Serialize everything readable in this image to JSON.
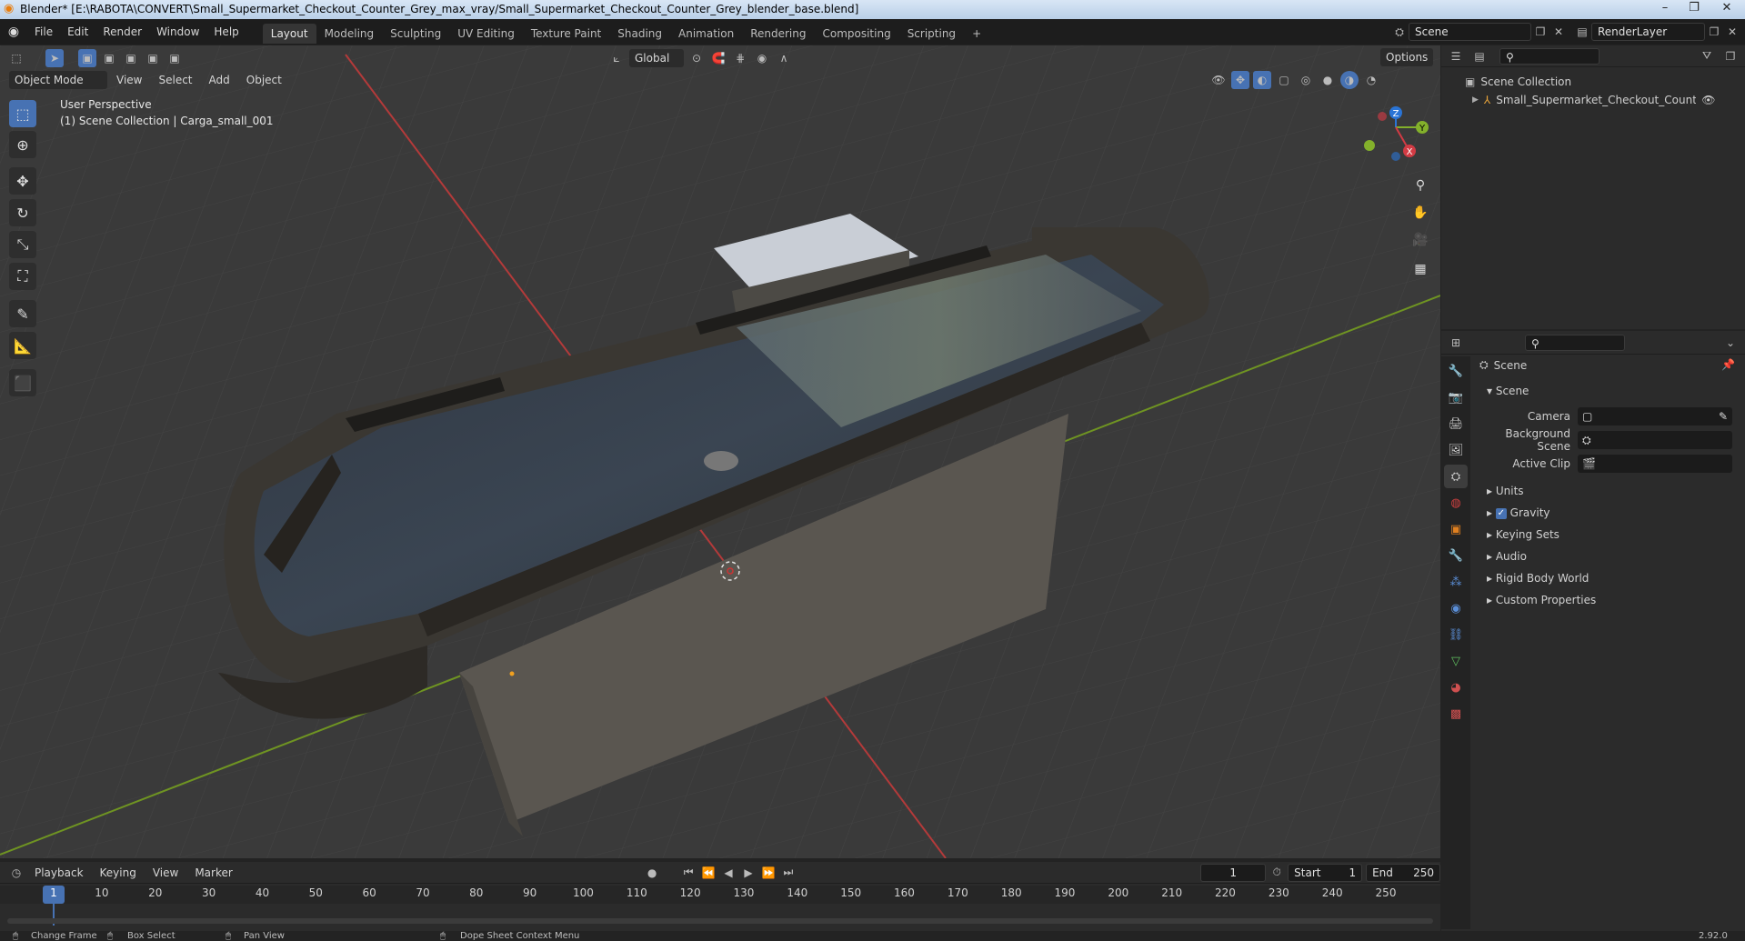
{
  "window": {
    "title": "Blender* [E:\\RABOTA\\CONVERT\\Small_Supermarket_Checkout_Counter_Grey_max_vray/Small_Supermarket_Checkout_Counter_Grey_blender_base.blend]",
    "minimize": "–",
    "maximize": "❐",
    "close": "✕"
  },
  "menu": {
    "items": [
      "File",
      "Edit",
      "Render",
      "Window",
      "Help"
    ],
    "workspaces": [
      "Layout",
      "Modeling",
      "Sculpting",
      "UV Editing",
      "Texture Paint",
      "Shading",
      "Animation",
      "Rendering",
      "Compositing",
      "Scripting"
    ],
    "add_workspace": "+",
    "scene_name": "Scene",
    "render_layer": "RenderLayer"
  },
  "viewport": {
    "mode": "Object Mode",
    "menus": [
      "View",
      "Select",
      "Add",
      "Object"
    ],
    "transform_orientation": "Global",
    "options": "Options",
    "overlay_line1": "User Perspective",
    "overlay_line2": "(1) Scene Collection | Carga_small_001",
    "gizmo_axes": {
      "z": "Z",
      "y": "Y",
      "x": "X"
    }
  },
  "outliner": {
    "root": "Scene Collection",
    "item": "Small_Supermarket_Checkout_Counter_Grey"
  },
  "properties": {
    "context": "Scene",
    "panel": "Scene",
    "fields": [
      {
        "label": "Camera",
        "value": ""
      },
      {
        "label": "Background Scene",
        "value": ""
      },
      {
        "label": "Active Clip",
        "value": ""
      }
    ],
    "sections": [
      "Units",
      "Gravity",
      "Keying Sets",
      "Audio",
      "Rigid Body World",
      "Custom Properties"
    ],
    "gravity_checked": true
  },
  "timeline": {
    "menus": [
      "Playback",
      "Keying",
      "View",
      "Marker"
    ],
    "current_frame": "1",
    "start_label": "Start",
    "start": "1",
    "end_label": "End",
    "end": "250",
    "ticks": [
      "1",
      "10",
      "20",
      "30",
      "40",
      "50",
      "60",
      "70",
      "80",
      "90",
      "100",
      "110",
      "120",
      "130",
      "140",
      "150",
      "160",
      "170",
      "180",
      "190",
      "200",
      "210",
      "220",
      "230",
      "240",
      "250"
    ]
  },
  "status": {
    "items": [
      "Change Frame",
      "Box Select",
      "Pan View",
      "Dope Sheet Context Menu"
    ],
    "version": "2.92.0"
  },
  "colors": {
    "accent": "#4772b3",
    "grid_red": "#c43c3c",
    "grid_green": "#7ea025"
  }
}
